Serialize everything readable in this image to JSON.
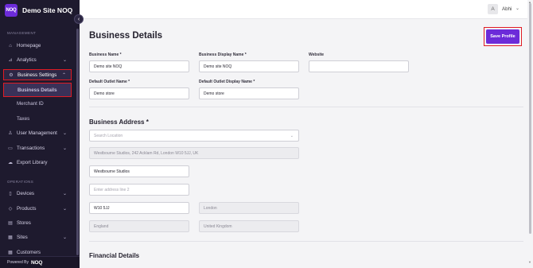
{
  "brand": {
    "logo_text": "NOQ",
    "title": "Demo Site NOQ"
  },
  "sidebar": {
    "collapse_icon": "chevron-left-icon",
    "management_label": "MANAGEMENT",
    "operations_label": "OPERATIONS",
    "items": [
      {
        "label": "Homepage",
        "icon": "home-icon"
      },
      {
        "label": "Analytics",
        "icon": "chart-icon"
      },
      {
        "label": "Business Settings",
        "icon": "gear-icon"
      },
      {
        "label": "Business Details"
      },
      {
        "label": "Merchant ID"
      },
      {
        "label": "Taxes"
      },
      {
        "label": "User Management",
        "icon": "user-icon"
      },
      {
        "label": "Transactions",
        "icon": "transactions-icon"
      },
      {
        "label": "Export Library",
        "icon": "cloud-export-icon"
      },
      {
        "label": "Devices",
        "icon": "device-icon"
      },
      {
        "label": "Products",
        "icon": "product-icon"
      },
      {
        "label": "Stores",
        "icon": "store-icon"
      },
      {
        "label": "Sites",
        "icon": "sites-icon"
      },
      {
        "label": "Customers",
        "icon": "customers-icon"
      }
    ],
    "powered_by": "Powered By",
    "powered_brand": "NOQ"
  },
  "topbar": {
    "avatar_letter": "A",
    "user_name": "Abhi"
  },
  "page": {
    "title": "Business Details",
    "save_label": "Save Profile",
    "fields": {
      "business_name_label": "Business Name *",
      "business_name_value": "Demo site NOQ",
      "display_name_label": "Business Display Name *",
      "display_name_value": "Demo site NOQ",
      "website_label": "Website",
      "website_value": "",
      "outlet_name_label": "Default Outlet Name *",
      "outlet_name_value": "Demo store",
      "outlet_display_label": "Default Outlet Display Name *",
      "outlet_display_value": "Demo store"
    },
    "address": {
      "title": "Business Address *",
      "search_placeholder": "Search Location",
      "full_address": "Westbourne Studios, 242 Acklam Rd, London W10 5JJ, UK",
      "line1": "Westbourne Studios",
      "line2_placeholder": "Enter address line 2",
      "postcode": "W10 5JJ",
      "city": "London",
      "region": "England",
      "country": "United Kingdom"
    },
    "financial_title": "Financial Details"
  },
  "colors": {
    "accent": "#6c2bd9",
    "sidebar_bg": "#1e1a2e",
    "highlight": "#e01b24"
  }
}
